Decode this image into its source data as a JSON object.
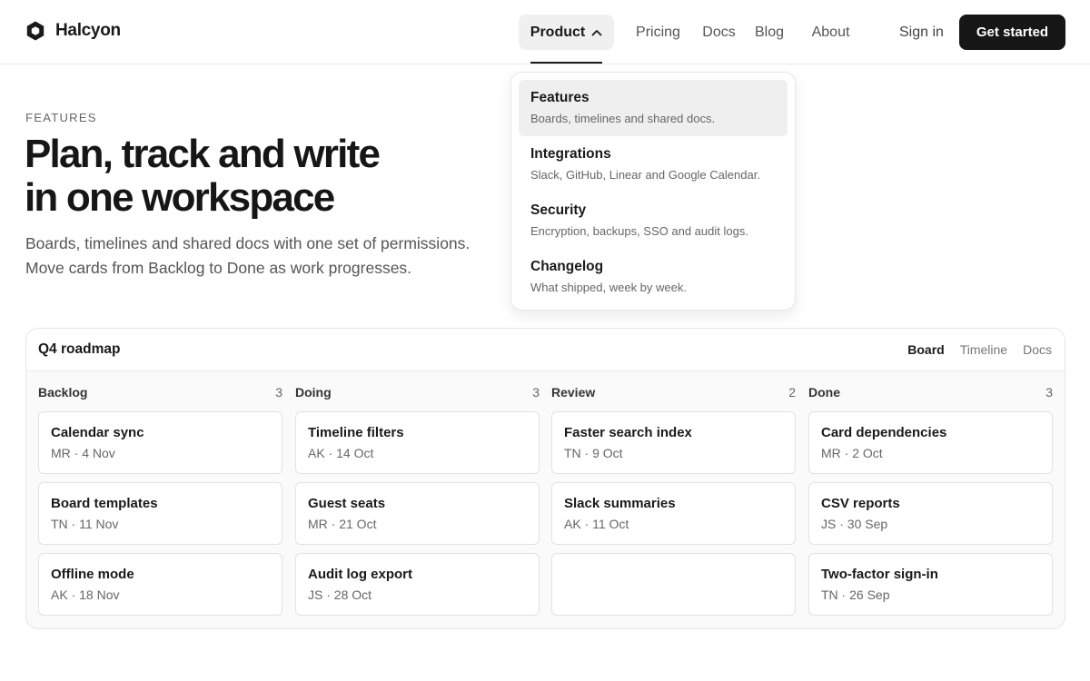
{
  "brand": {
    "name": "Halcyon"
  },
  "nav": {
    "product": "Product",
    "pricing": "Pricing",
    "docs": "Docs",
    "blog": "Blog",
    "about": "About",
    "sign_in": "Sign in",
    "get_started": "Get started"
  },
  "hero": {
    "eyebrow": "FEATURES",
    "headline_line1": "Plan, track and write",
    "headline_line2": "in one workspace",
    "lead_line1": "Boards, timelines and shared docs with one set of permissions.",
    "lead_line2": "Move cards from Backlog to Done as work progresses."
  },
  "dropdown": {
    "items": [
      {
        "title": "Features",
        "desc": "Boards, timelines and shared docs."
      },
      {
        "title": "Integrations",
        "desc": "Slack, GitHub, Linear and Google Calendar."
      },
      {
        "title": "Security",
        "desc": "Encryption, backups, SSO and audit logs."
      },
      {
        "title": "Changelog",
        "desc": "What shipped, week by week."
      }
    ]
  },
  "board": {
    "title": "Q4 roadmap",
    "views": [
      "Board",
      "Timeline",
      "Docs"
    ],
    "columns": [
      {
        "name": "Backlog",
        "count": "3",
        "cards": [
          {
            "title": "Calendar sync",
            "meta": "MR · 4 Nov"
          },
          {
            "title": "Board templates",
            "meta": "TN · 11 Nov"
          },
          {
            "title": "Offline mode",
            "meta": "AK · 18 Nov"
          }
        ]
      },
      {
        "name": "Doing",
        "count": "3",
        "cards": [
          {
            "title": "Timeline filters",
            "meta": "AK · 14 Oct"
          },
          {
            "title": "Guest seats",
            "meta": "MR · 21 Oct"
          },
          {
            "title": "Audit log export",
            "meta": "JS · 28 Oct"
          }
        ]
      },
      {
        "name": "Review",
        "count": "2",
        "cards": [
          {
            "title": "Faster search index",
            "meta": "TN · 9 Oct"
          },
          {
            "title": "Slack summaries",
            "meta": "AK · 11 Oct"
          }
        ]
      },
      {
        "name": "Done",
        "count": "3",
        "cards": [
          {
            "title": "Card dependencies",
            "meta": "MR · 2 Oct"
          },
          {
            "title": "CSV reports",
            "meta": "JS · 30 Sep"
          },
          {
            "title": "Two-factor sign-in",
            "meta": "TN · 26 Sep"
          }
        ]
      }
    ]
  }
}
